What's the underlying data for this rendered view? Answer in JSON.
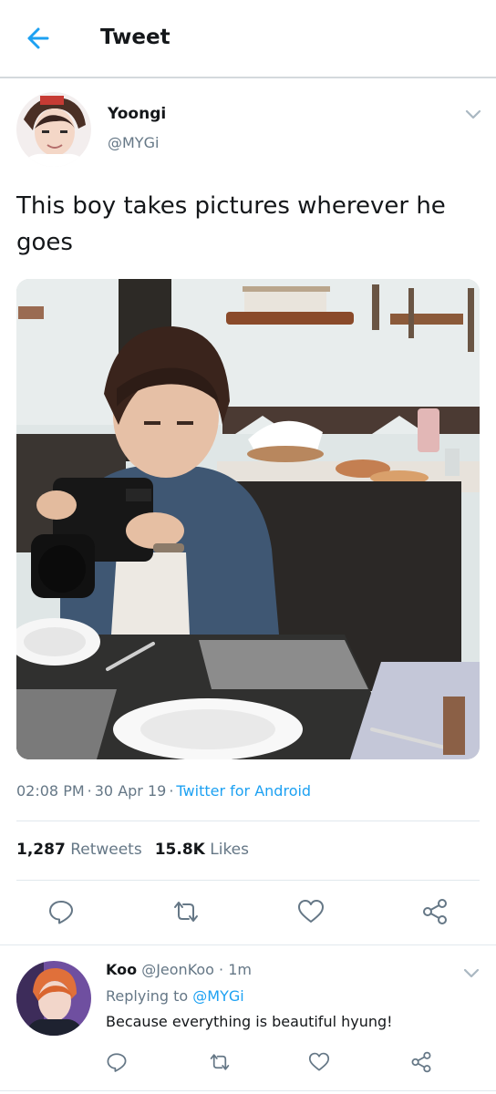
{
  "header": {
    "title": "Tweet",
    "back_icon": "arrow-left-icon",
    "accent": "#1da1f2"
  },
  "tweet": {
    "author_name": "Yoongi",
    "author_handle": "@MYGi",
    "text": "This boy takes pictures wherever he goes",
    "time": "02:08 PM",
    "date": "30 Apr 19",
    "source": "Twitter for Android",
    "retweets_count": "1,287",
    "retweets_label": "Retweets",
    "likes_count": "15.8K",
    "likes_label": "Likes",
    "actions": [
      "reply-icon",
      "retweet-icon",
      "like-icon",
      "share-icon"
    ]
  },
  "reply": {
    "author_name": "Koo",
    "author_handle": "@JeonKoo",
    "time": "1m",
    "replying_label": "Replying to",
    "replying_to": "@MYGi",
    "text": "Because everything is beautiful hyung!"
  }
}
